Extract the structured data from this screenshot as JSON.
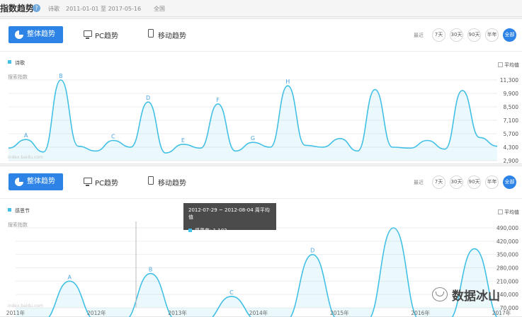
{
  "topbar": {
    "title": "指数趋势",
    "help": "?",
    "keyword": "诗歌",
    "date_range": "2011-01-01 至 2017-05-16",
    "region": "全国"
  },
  "tabs": {
    "overall": "整体趋势",
    "pc": "PC趋势",
    "mobile": "移动趋势"
  },
  "ranges": {
    "label": "最近",
    "options": [
      "7天",
      "30天",
      "90天",
      "半年",
      "全部"
    ],
    "active": "全部"
  },
  "avg_label": "平均值",
  "ylabel": "搜索指数",
  "watermark": "index.baidu.com",
  "colors": {
    "accent": "#2d84e6",
    "series": "#42c0e5"
  },
  "icons": {
    "overall": "pie-chart-icon",
    "pc": "monitor-icon",
    "mobile": "mobile-icon",
    "logo": "wechat-icon"
  },
  "chart_data": [
    {
      "type": "area",
      "title": "",
      "series": [
        {
          "name": "诗歌",
          "values": [
            4200,
            5100,
            3800,
            11300,
            4400,
            3900,
            5000,
            4300,
            9000,
            3700,
            4600,
            4200,
            8800,
            3900,
            4800,
            4300,
            10700,
            4500,
            4300,
            5200,
            3900,
            10300,
            4300,
            4200,
            5000,
            4100,
            10200,
            5300,
            4400
          ]
        }
      ],
      "yticks": [
        "11,300",
        "9,900",
        "8,500",
        "7,100",
        "5,700",
        "4,300",
        "2,900"
      ],
      "annotations": [
        "A",
        "B",
        "C",
        "D",
        "E",
        "F",
        "G",
        "H"
      ],
      "grid": true
    },
    {
      "type": "area",
      "title": "",
      "series": [
        {
          "name": "感恩节",
          "values": [
            1102,
            1102,
            210000,
            1102,
            1102,
            250000,
            1102,
            1102,
            130000,
            1102,
            1102,
            350000,
            1102,
            1102,
            490000,
            1102,
            1102,
            380000,
            1102
          ]
        }
      ],
      "yticks": [
        "490,000",
        "420,000",
        "350,000",
        "280,000",
        "210,000",
        "140,000",
        "70,000"
      ],
      "xticks": [
        "2011年",
        "2012年",
        "2013年",
        "2014年",
        "2015年",
        "2016年",
        "2017年"
      ],
      "annotations": [
        "A",
        "B",
        "C",
        "D"
      ],
      "grid": true
    }
  ],
  "tooltip": {
    "title": "2012-07-29 ~ 2012-08-04 周平均值",
    "series_label": "感恩节",
    "value": "1,102"
  },
  "brand": "数据冰山"
}
